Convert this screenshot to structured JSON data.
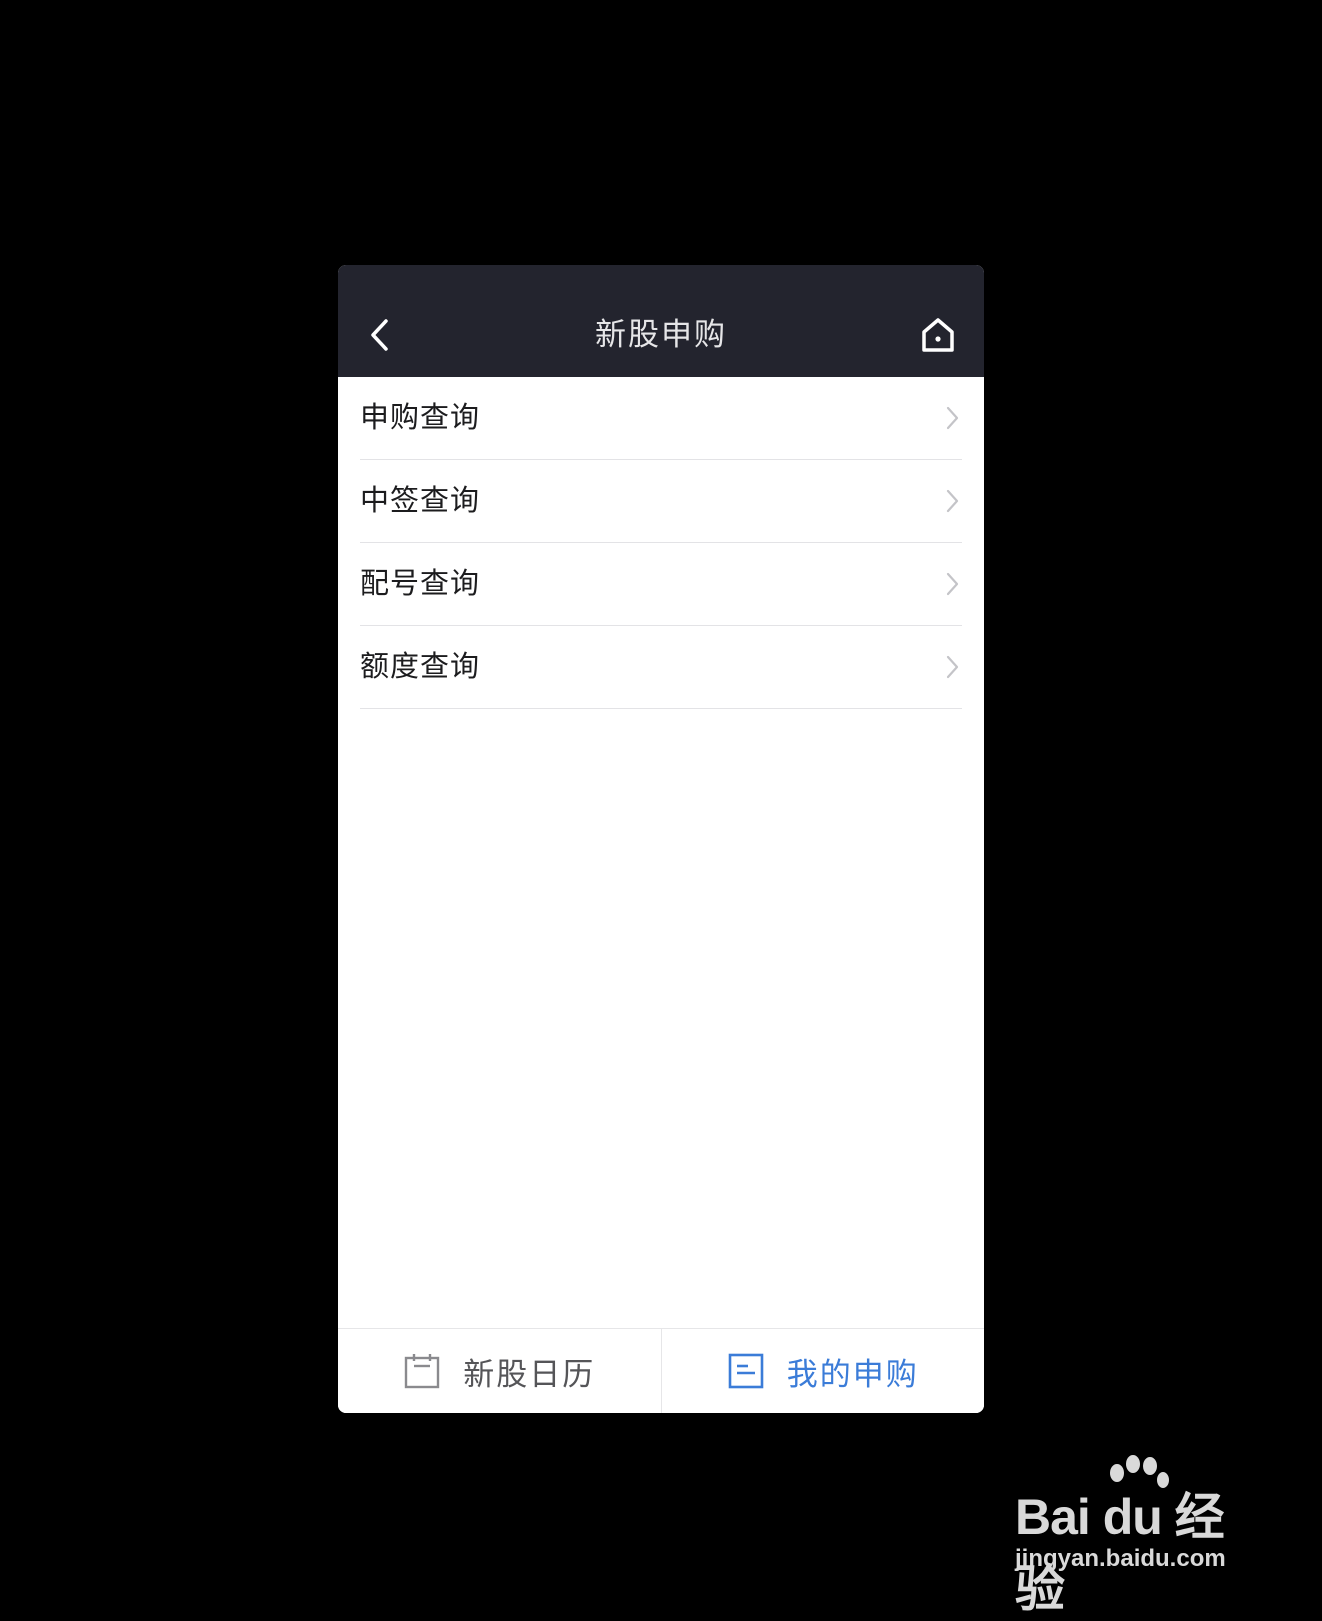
{
  "navbar": {
    "title": "新股申购",
    "back_icon": "back-chevron-icon",
    "home_icon": "home-icon",
    "background": "#23242e"
  },
  "menu": {
    "items": [
      {
        "label": "申购查询"
      },
      {
        "label": "中签查询"
      },
      {
        "label": "配号查询"
      },
      {
        "label": "额度查询"
      }
    ]
  },
  "tabbar": {
    "tabs": [
      {
        "label": "新股日历",
        "icon": "calendar-icon",
        "active": false
      },
      {
        "label": "我的申购",
        "icon": "document-icon",
        "active": true
      }
    ],
    "active_color": "#3b7cd8"
  },
  "watermark": {
    "brand": "Bai du 经验",
    "url": "jingyan.baidu.com"
  }
}
